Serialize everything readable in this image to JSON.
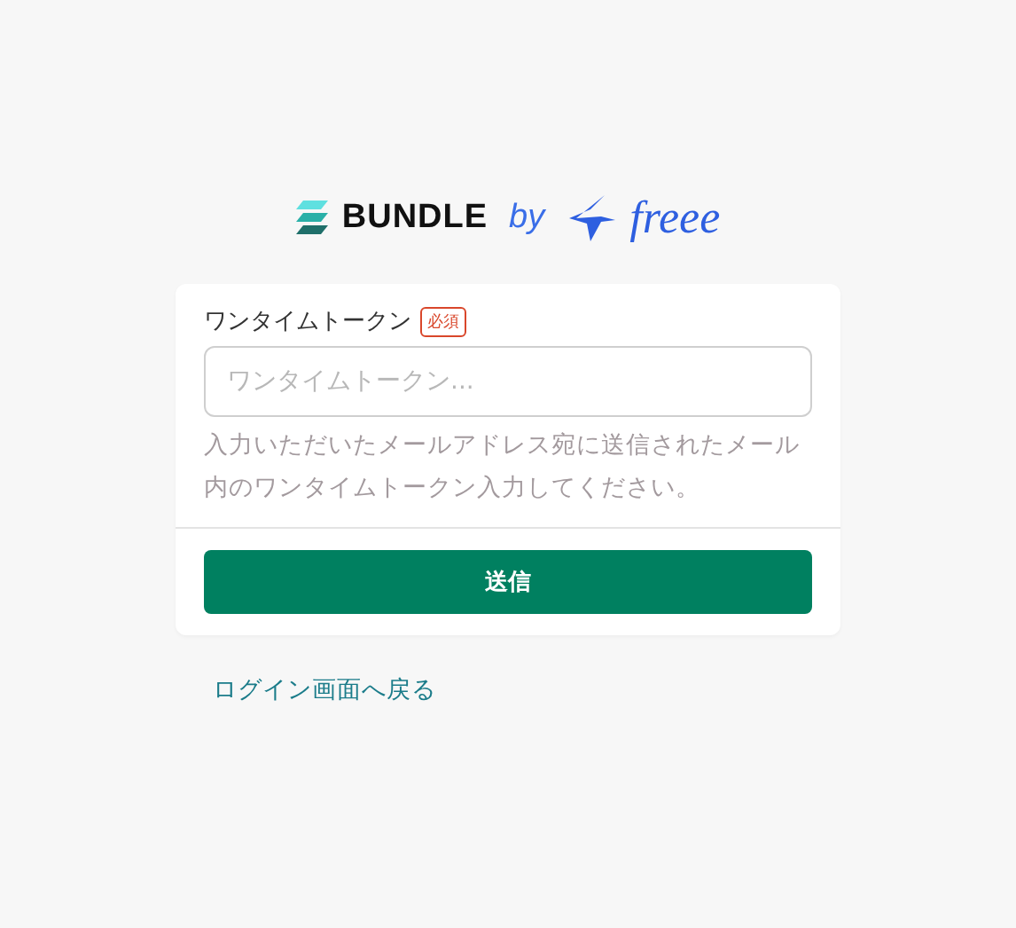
{
  "logo": {
    "product": "BUNDLE",
    "by": "by",
    "partner": "freee"
  },
  "form": {
    "label": "ワンタイムトークン",
    "required_badge": "必須",
    "field": {
      "placeholder": "ワンタイムトークン..."
    },
    "help": "入力いただいたメールアドレス宛に送信されたメール内のワンタイムトークン入力してください。",
    "submit": "送信"
  },
  "back_link": "ログイン画面へ戻る"
}
